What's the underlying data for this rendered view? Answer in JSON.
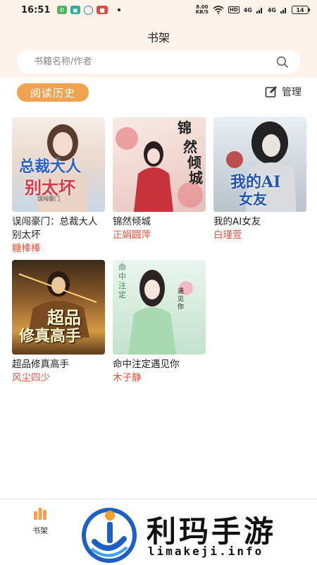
{
  "status_bar": {
    "time": "16:51",
    "net_speed_value": "8.00",
    "net_speed_unit": "KB/S",
    "hd": "HD",
    "signal1": "4G",
    "signal2": "4G",
    "battery": "14"
  },
  "header": {
    "title": "书架",
    "search_placeholder": "书籍名称/作者"
  },
  "section": {
    "history_tab": "阅读历史",
    "manage_label": "管理"
  },
  "books": [
    {
      "title": "误闯豪门：总裁大人别太坏",
      "author": "糖棒棒",
      "cover_text": [
        "总裁大人",
        "别太坏"
      ],
      "cover_caption": "误闯豪门"
    },
    {
      "title": "锦然倾城",
      "author": "正娟圆萍",
      "cover_text": [
        "锦",
        "然",
        "倾",
        "城"
      ]
    },
    {
      "title": "我的AI女友",
      "author": "白瑾萱",
      "cover_text": [
        "我的AI",
        "女友"
      ]
    },
    {
      "title": "超品修真高手",
      "author": "风尘四少",
      "cover_text": [
        "超品",
        "修真高手"
      ]
    },
    {
      "title": "命中注定遇见你",
      "author": "木子静",
      "cover_text": [
        "命中注定",
        "遇见你"
      ]
    }
  ],
  "nav": {
    "bookshelf_label": "书架"
  },
  "watermark": {
    "main": "利玛手游",
    "sub": "limakeji.info"
  },
  "colors": {
    "accent": "#f0a24f",
    "header_bg": "#fdf3ea",
    "author_red": "#e0533b"
  }
}
